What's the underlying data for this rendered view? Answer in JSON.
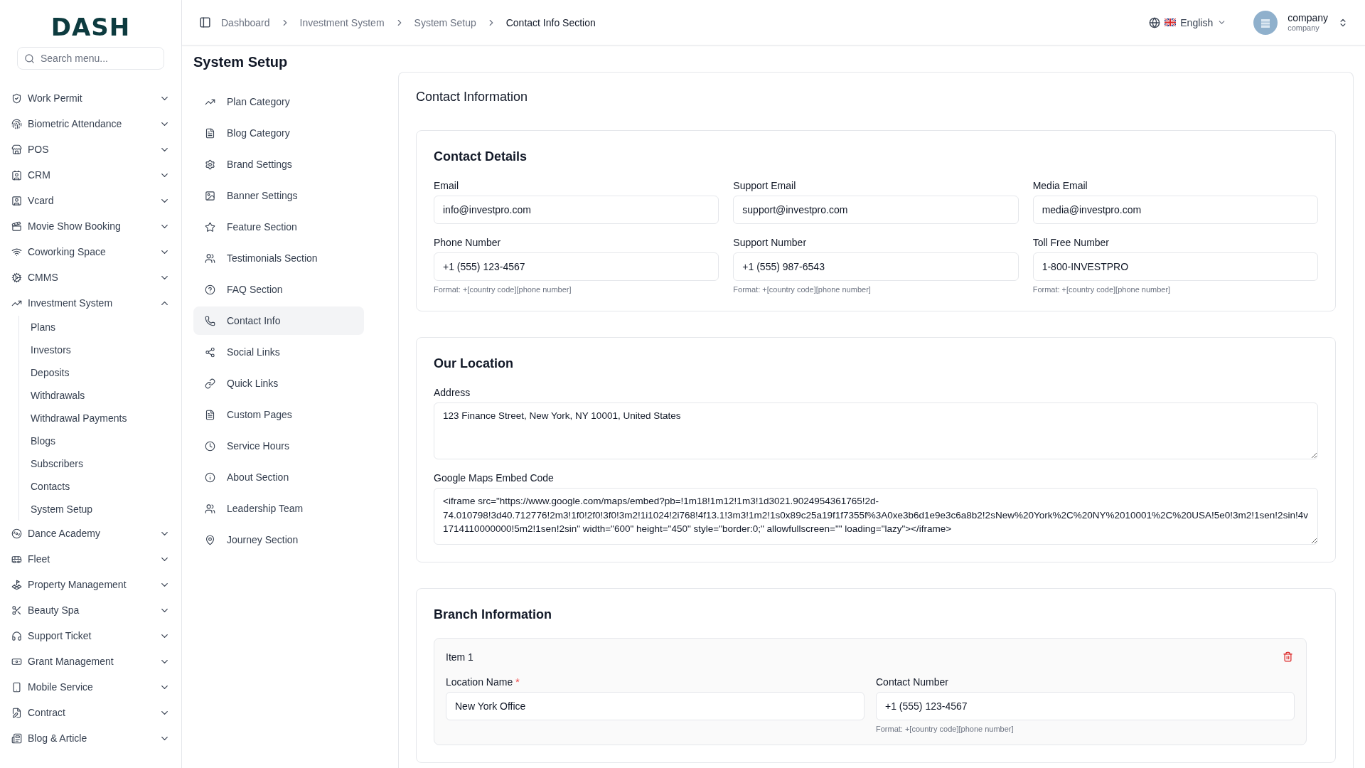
{
  "sidebar": {
    "logo": "DASH",
    "search": {
      "placeholder": "Search menu..."
    },
    "items": [
      {
        "label": "Work Permit",
        "expanded": false
      },
      {
        "label": "Biometric Attendance",
        "expanded": false
      },
      {
        "label": "POS",
        "expanded": false
      },
      {
        "label": "CRM",
        "expanded": false
      },
      {
        "label": "Vcard",
        "expanded": false
      },
      {
        "label": "Movie Show Booking",
        "expanded": false
      },
      {
        "label": "Coworking Space",
        "expanded": false
      },
      {
        "label": "CMMS",
        "expanded": false
      },
      {
        "label": "Investment System",
        "expanded": true,
        "children": [
          {
            "label": "Plans"
          },
          {
            "label": "Investors"
          },
          {
            "label": "Deposits"
          },
          {
            "label": "Withdrawals"
          },
          {
            "label": "Withdrawal Payments"
          },
          {
            "label": "Blogs"
          },
          {
            "label": "Subscribers"
          },
          {
            "label": "Contacts"
          },
          {
            "label": "System Setup"
          }
        ]
      },
      {
        "label": "Dance Academy",
        "expanded": false
      },
      {
        "label": "Fleet",
        "expanded": false
      },
      {
        "label": "Property Management",
        "expanded": false
      },
      {
        "label": "Beauty Spa",
        "expanded": false
      },
      {
        "label": "Support Ticket",
        "expanded": false
      },
      {
        "label": "Grant Management",
        "expanded": false
      },
      {
        "label": "Mobile Service",
        "expanded": false
      },
      {
        "label": "Contract",
        "expanded": false
      },
      {
        "label": "Blog & Article",
        "expanded": false
      }
    ]
  },
  "topbar": {
    "breadcrumbs": [
      "Dashboard",
      "Investment System",
      "System Setup",
      "Contact Info Section"
    ],
    "language": "English",
    "user": {
      "name": "company",
      "role": "company"
    }
  },
  "page_title": "System Setup",
  "settings_menu": [
    {
      "label": "Plan Category",
      "selected": false
    },
    {
      "label": "Blog Category",
      "selected": false
    },
    {
      "label": "Brand Settings",
      "selected": false
    },
    {
      "label": "Banner Settings",
      "selected": false
    },
    {
      "label": "Feature Section",
      "selected": false
    },
    {
      "label": "Testimonials Section",
      "selected": false
    },
    {
      "label": "FAQ Section",
      "selected": false
    },
    {
      "label": "Contact Info",
      "selected": true
    },
    {
      "label": "Social Links",
      "selected": false
    },
    {
      "label": "Quick Links",
      "selected": false
    },
    {
      "label": "Custom Pages",
      "selected": false
    },
    {
      "label": "Service Hours",
      "selected": false
    },
    {
      "label": "About Section",
      "selected": false
    },
    {
      "label": "Leadership Team",
      "selected": false
    },
    {
      "label": "Journey Section",
      "selected": false
    }
  ],
  "content": {
    "title": "Contact Information",
    "contact_details": {
      "title": "Contact Details",
      "fields": [
        {
          "label": "Email",
          "value": "info@investpro.com"
        },
        {
          "label": "Support Email",
          "value": "support@investpro.com"
        },
        {
          "label": "Media Email",
          "value": "media@investpro.com"
        },
        {
          "label": "Phone Number",
          "value": "+1 (555) 123-4567",
          "hint": "Format: +[country code][phone number]"
        },
        {
          "label": "Support Number",
          "value": "+1 (555) 987-6543",
          "hint": "Format: +[country code][phone number]"
        },
        {
          "label": "Toll Free Number",
          "value": "1-800-INVESTPRO",
          "hint": "Format: +[country code][phone number]"
        }
      ]
    },
    "location": {
      "title": "Our Location",
      "address_label": "Address",
      "address": "123 Finance Street, New York, NY 10001, United States",
      "maps_label": "Google Maps Embed Code",
      "maps_code": "<iframe src=\"https://www.google.com/maps/embed?pb=!1m18!1m12!1m3!1d3021.9024954361765!2d-74.010798!3d40.712776!2m3!1f0!2f0!3f0!3m2!1i1024!2i768!4f13.1!3m3!1m2!1s0x89c25a19f1f7355f%3A0xe3b6d1e9e3c6a8b2!2sNew%20York%2C%20NY%2010001%2C%20USA!5e0!3m2!1sen!2sin!4v1714110000000!5m2!1sen!2sin\" width=\"600\" height=\"450\" style=\"border:0;\" allowfullscreen=\"\" loading=\"lazy\"></iframe>"
    },
    "branches": {
      "title": "Branch Information",
      "items": [
        {
          "title": "Item 1",
          "fields": [
            {
              "label": "Location Name",
              "required_mark": "*",
              "value": "New York Office"
            },
            {
              "label": "Contact Number",
              "value": "+1 (555) 123-4567",
              "hint": "Format: +[country code][phone number]"
            }
          ]
        }
      ]
    }
  }
}
